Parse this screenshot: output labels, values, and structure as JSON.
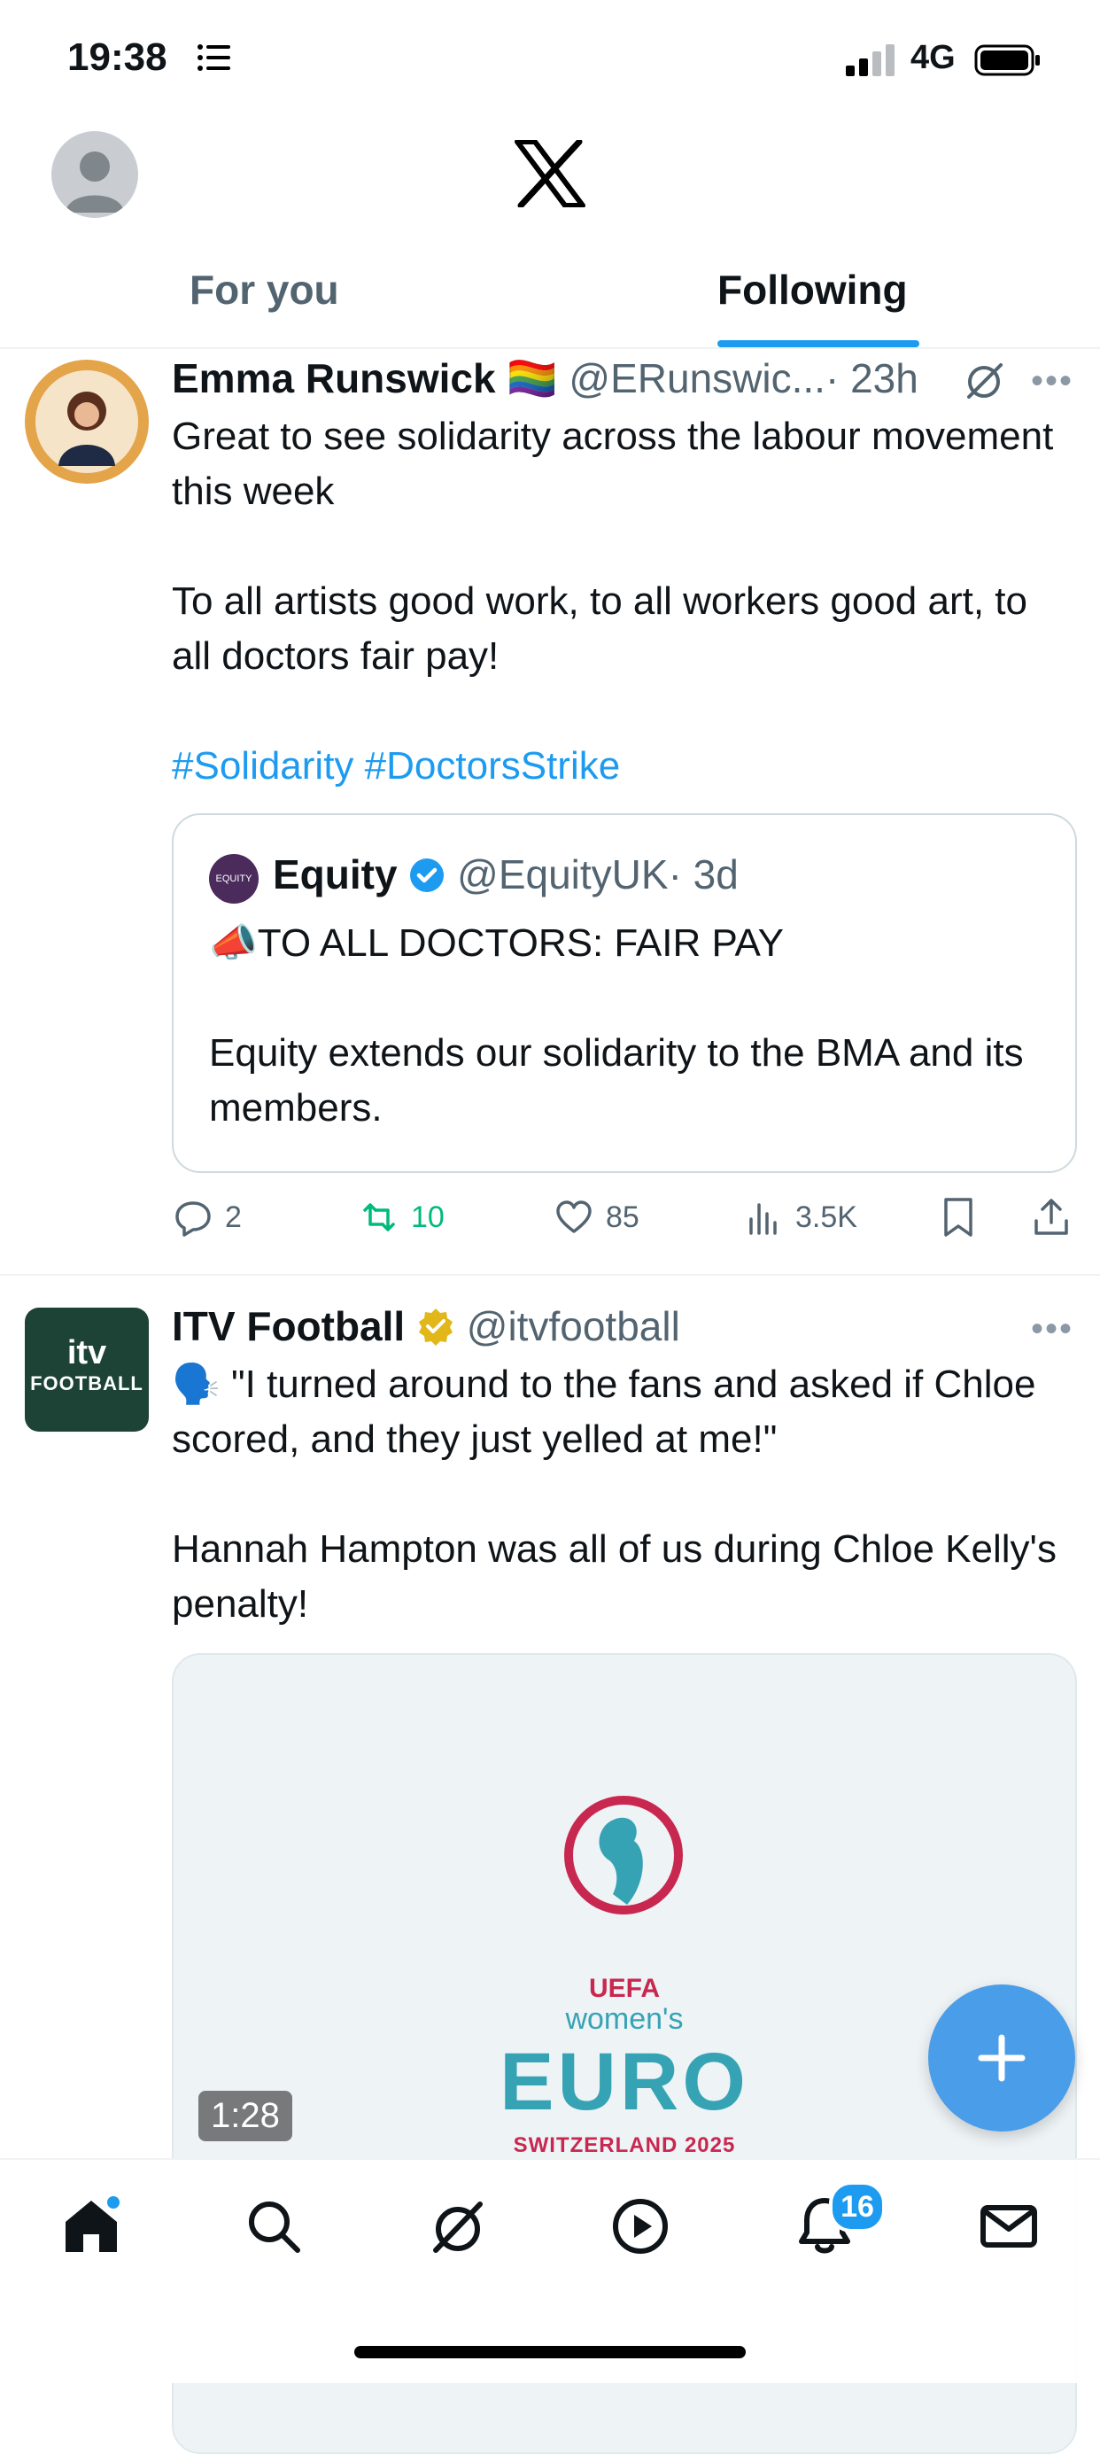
{
  "status_bar": {
    "time": "19:38",
    "network": "4G"
  },
  "tabs": [
    {
      "label": "For you",
      "active": false
    },
    {
      "label": "Following",
      "active": true
    }
  ],
  "colors": {
    "accent": "#1d9bf0",
    "retweeted": "#00ba7c",
    "fab": "#4a9de8"
  },
  "tweets": [
    {
      "name": "Emma Runswick",
      "flag": "🏳️‍🌈",
      "handle": "@ERunswic...",
      "time": "· 23h",
      "body": [
        "Great to see solidarity across the labour movement this week",
        "To all artists good work, to all workers good art, to all doctors fair pay!"
      ],
      "hashtags": "#Solidarity #DoctorsStrike",
      "quote": {
        "name": "Equity",
        "handle": "@EquityUK",
        "time": "· 3d",
        "avatar_text": "EQUITY",
        "line1": "📣TO ALL DOCTORS: FAIR PAY",
        "line2": "Equity extends our solidarity to the BMA and its members."
      },
      "actions": {
        "replies": "2",
        "retweets": "10",
        "likes": "85",
        "views": "3.5K"
      }
    },
    {
      "name": "ITV Football",
      "handle": "@itvfootball",
      "avatar_line1": "itv",
      "avatar_line2": "FOOTBALL",
      "body": [
        "🗣️ \"I turned around to the fans and asked if Chloe scored, and they just yelled at me!\"",
        "Hannah Hampton was all of us during Chloe Kelly's penalty!"
      ],
      "media": {
        "logo_uefa": "UEFA",
        "logo_line": "women's",
        "logo_euro": "EURO",
        "logo_sub": "SWITZERLAND 2025",
        "duration": "1:28"
      }
    }
  ],
  "bottom_nav": {
    "items": [
      "home-icon",
      "search-icon",
      "grok-icon",
      "video-icon",
      "notifications-icon",
      "messages-icon"
    ],
    "notification_count": "16"
  }
}
